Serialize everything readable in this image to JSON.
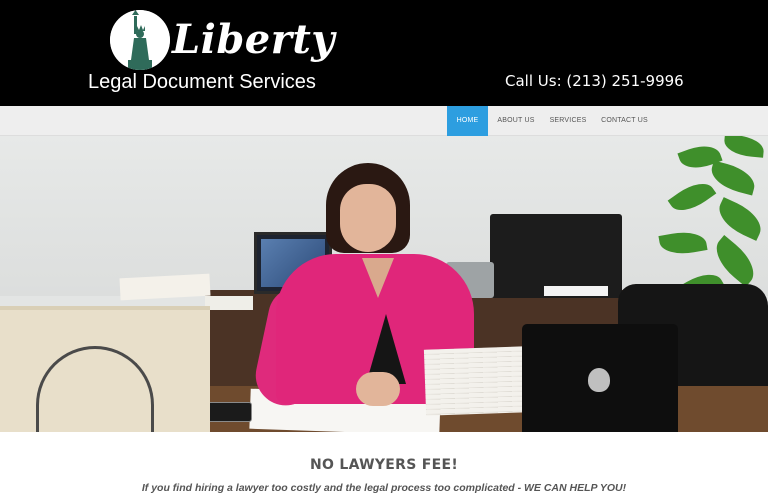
{
  "header": {
    "logo_script": "Liberty",
    "logo_subtitle": "Legal Document Services",
    "phone_text": "Call Us: (213) 251-9996",
    "logo_icon": "statue-of-liberty-icon"
  },
  "nav": {
    "items": [
      {
        "label": "HOME",
        "active": true
      },
      {
        "label": "ABOUT US",
        "active": false
      },
      {
        "label": "SERVICES",
        "active": false
      },
      {
        "label": "CONTACT US",
        "active": false
      }
    ],
    "active_color": "#2d9ee0"
  },
  "hero": {
    "image_subject": "hero-photo-woman-at-desk"
  },
  "intro": {
    "title": "NO LAWYERS FEE!",
    "text": "If you find hiring a lawyer too costly and the legal process too complicated -  WE CAN HELP YOU!"
  }
}
